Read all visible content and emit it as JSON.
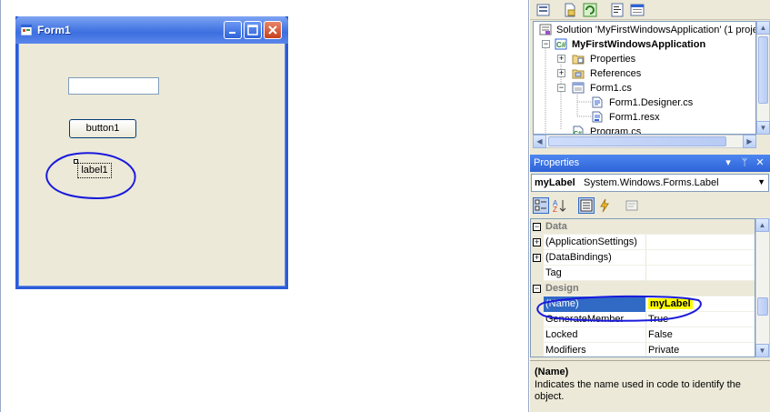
{
  "designer": {
    "form_title": "Form1",
    "button_label": "button1",
    "label_text": "label1"
  },
  "solution_explorer": {
    "items": [
      {
        "label": "Solution 'MyFirstWindowsApplication' (1 proje"
      },
      {
        "label": "MyFirstWindowsApplication"
      },
      {
        "label": "Properties"
      },
      {
        "label": "References"
      },
      {
        "label": "Form1.cs"
      },
      {
        "label": "Form1.Designer.cs"
      },
      {
        "label": "Form1.resx"
      },
      {
        "label": "Program.cs"
      }
    ],
    "expanders": [
      "−",
      "+",
      "+",
      "−"
    ]
  },
  "properties": {
    "panel_title": "Properties",
    "header_buttons": [
      "▾",
      "ᛘ",
      "✕"
    ],
    "object_name": "myLabel",
    "object_type": "System.Windows.Forms.Label",
    "rows": [
      {
        "name": "Data",
        "value": "",
        "expander": "−"
      },
      {
        "name": "(ApplicationSettings)",
        "value": "",
        "expander": "+"
      },
      {
        "name": "(DataBindings)",
        "value": "",
        "expander": "+"
      },
      {
        "name": "Tag",
        "value": "",
        "expander": ""
      },
      {
        "name": "Design",
        "value": "",
        "expander": "−"
      },
      {
        "name": "(Name)",
        "value": "myLabel",
        "expander": ""
      },
      {
        "name": "GenerateMember",
        "value": "True",
        "expander": ""
      },
      {
        "name": "Locked",
        "value": "False",
        "expander": ""
      },
      {
        "name": "Modifiers",
        "value": "Private",
        "expander": ""
      }
    ],
    "description_title": "(Name)",
    "description_text": "Indicates the name used in code to identify the object."
  },
  "colors": {
    "selection": "#316ac5",
    "highlight": "#ffff00",
    "ink": "#1a1adc",
    "titlebar": "#3c6fe0"
  },
  "icons": [
    "form-icon",
    "minimize-icon",
    "maximize-icon",
    "close-icon",
    "solution-icon",
    "project-icon",
    "folder-icon",
    "references-icon",
    "form-file-icon",
    "code-file-icon",
    "resx-file-icon",
    "categorized-icon",
    "alphabetical-icon",
    "properties-view-icon",
    "events-icon",
    "property-pages-icon"
  ]
}
